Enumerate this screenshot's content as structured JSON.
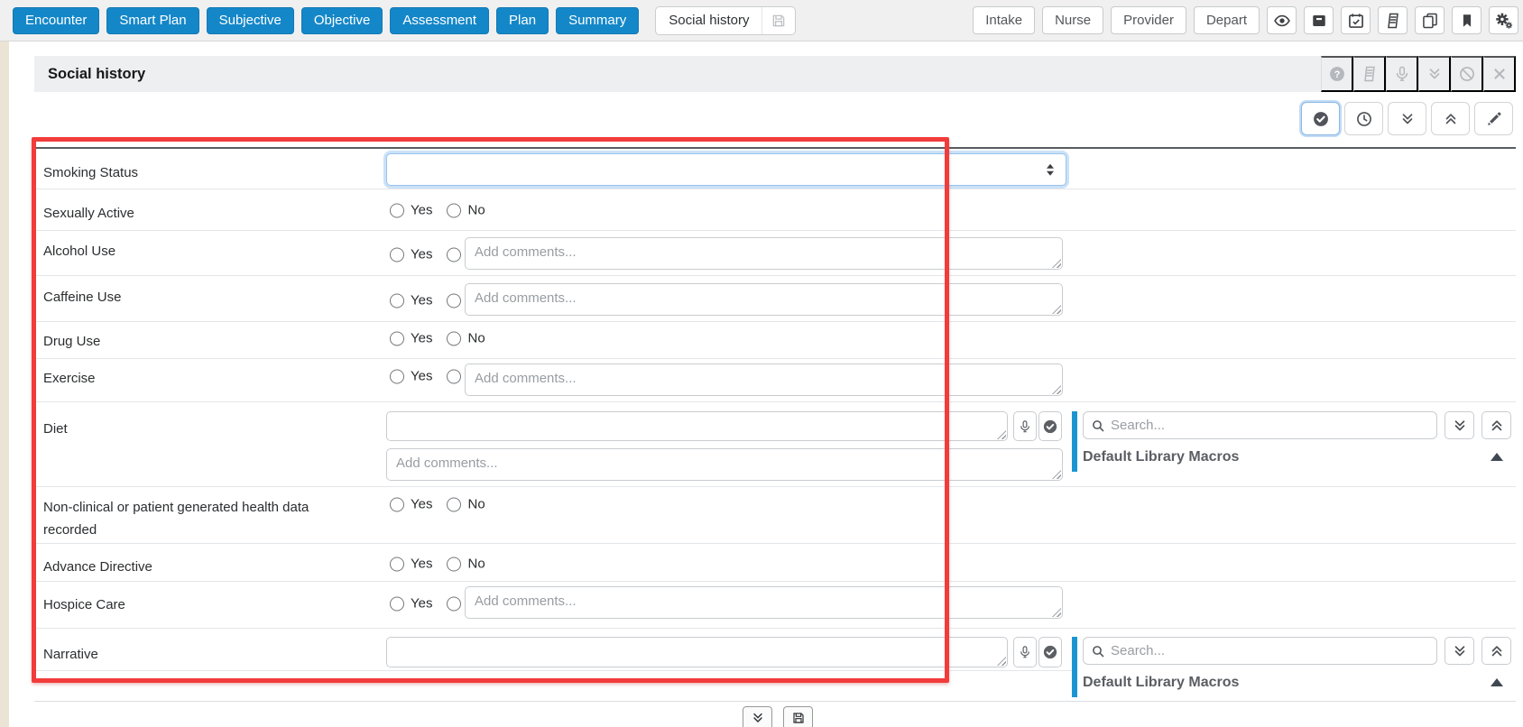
{
  "toolbar": {
    "nav": [
      "Encounter",
      "Smart Plan",
      "Subjective",
      "Objective",
      "Assessment",
      "Plan",
      "Summary"
    ],
    "active_tab": "Social history",
    "tab_save_icon": "save-icon",
    "role_buttons": [
      "Intake",
      "Nurse",
      "Provider",
      "Depart"
    ],
    "icon_buttons": [
      "eye-icon",
      "archive-icon",
      "calendar-check-icon",
      "book-icon",
      "copy-icon",
      "bookmark-icon",
      "gear-icon"
    ]
  },
  "section": {
    "title": "Social history",
    "header_icons": [
      "help-icon",
      "book-icon",
      "mic-icon",
      "chevrons-down-icon",
      "ban-icon",
      "close-icon"
    ],
    "action_icons": [
      "check-circle-icon",
      "clock-icon",
      "chevrons-down-icon",
      "chevrons-up-icon",
      "pencil-icon"
    ]
  },
  "form": {
    "yes_label": "Yes",
    "no_label": "No",
    "comments_placeholder": "Add comments...",
    "rows": [
      {
        "label": "Smoking Status",
        "type": "select",
        "value": ""
      },
      {
        "label": "Sexually Active",
        "type": "radio"
      },
      {
        "label": "Alcohol Use",
        "type": "radio-comments"
      },
      {
        "label": "Caffeine Use",
        "type": "radio-comments"
      },
      {
        "label": "Drug Use",
        "type": "radio"
      },
      {
        "label": "Exercise",
        "type": "radio-comments"
      },
      {
        "label": "Diet",
        "type": "text-comments",
        "value": "",
        "row_icons": [
          "mic-icon",
          "check-circle-icon"
        ]
      },
      {
        "label": "Non-clinical or patient generated health data recorded",
        "type": "radio"
      },
      {
        "label": "Advance Directive",
        "type": "radio"
      },
      {
        "label": "Hospice Care",
        "type": "radio-comments"
      },
      {
        "label": "Narrative",
        "type": "text",
        "value": "",
        "row_icons": [
          "mic-icon",
          "check-circle-icon"
        ]
      }
    ]
  },
  "macros_panel": {
    "search_placeholder": "Search...",
    "search_value": "",
    "title": "Default Library Macros",
    "icons": [
      "search-icon",
      "chevrons-down-icon",
      "chevrons-up-icon",
      "caret-up-icon"
    ]
  },
  "footer": {
    "icons": [
      "chevrons-down-icon",
      "save-icon"
    ]
  },
  "colors": {
    "primary_blue": "#1487c8",
    "accent_bar_blue": "#1b95d2",
    "highlight_red": "#f13c3b",
    "focus_border_blue": "#97c4ee"
  }
}
